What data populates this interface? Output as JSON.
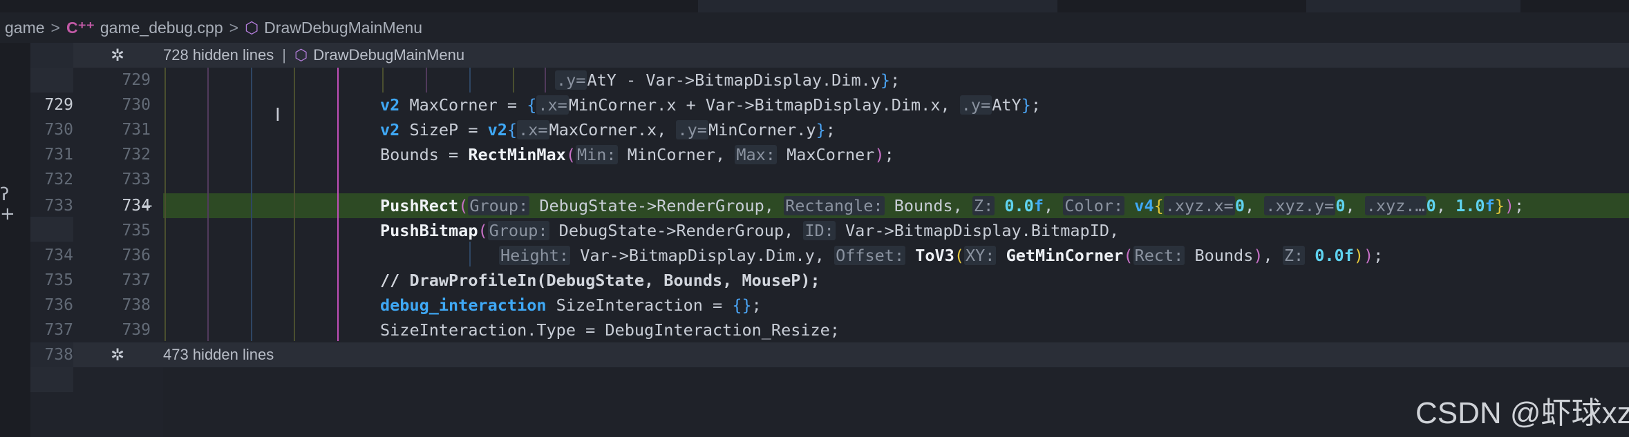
{
  "breadcrumb": {
    "folder": "game",
    "file": "game_debug.cpp",
    "symbol": "DrawDebugMainMenu",
    "separator": ">",
    "file_icon": "cpp-file-icon",
    "symbol_icon": "cube-symbol-icon"
  },
  "fold_top": {
    "icon": "fold-expand-icon",
    "text": "728 hidden lines",
    "separator": "|",
    "symbol": "DrawDebugMainMenu"
  },
  "fold_bottom": {
    "icon": "fold-expand-icon",
    "text": "473 hidden lines",
    "old_line": "738"
  },
  "rows": [
    {
      "old": "",
      "new": "729"
    },
    {
      "old": "729",
      "new": "730"
    },
    {
      "old": "730",
      "new": "731"
    },
    {
      "old": "731",
      "new": "732"
    },
    {
      "old": "732",
      "new": "733"
    },
    {
      "old": "733",
      "new": "734",
      "marker": "+"
    },
    {
      "old": "",
      "new": "735"
    },
    {
      "old": "734",
      "new": "736"
    },
    {
      "old": "735",
      "new": "737"
    },
    {
      "old": "736",
      "new": "738"
    },
    {
      "old": "737",
      "new": "739"
    }
  ],
  "code": {
    "l1": {
      "a": ".y=",
      "b": "AtY - Var->BitmapDisplay.Dim.y",
      "c": "}",
      "d": ";"
    },
    "l2": {
      "kw": "v2",
      "a": " MaxCorner = ",
      "b": "{",
      "h1": ".x=",
      "c": "MinCorner.x + Var->BitmapDisplay.Dim.x, ",
      "h2": ".y=",
      "d": "AtY",
      "e": "}",
      "f": ";"
    },
    "l3": {
      "kw1": "v2",
      "a": " SizeP = ",
      "kw2": "v2",
      "b": "{",
      "h1": ".x=",
      "c": "MaxCorner.x, ",
      "h2": ".y=",
      "d": "MinCorner.y",
      "e": "}",
      "f": ";"
    },
    "l4": {
      "a": "Bounds = ",
      "fn": "RectMinMax",
      "b": "(",
      "h1": "Min:",
      "c": " MinCorner, ",
      "h2": "Max:",
      "d": " MaxCorner",
      "e": ")",
      "f": ";"
    },
    "l6": {
      "fn": "PushRect",
      "b": "(",
      "h1": "Group:",
      "c": " DebugState->RenderGroup, ",
      "h2": "Rectangle:",
      "d": " Bounds, ",
      "h3": "Z:",
      "n1": " 0.0",
      "f1": "f",
      "e": ", ",
      "h4": "Color:",
      "kw": " v4",
      "g": "{",
      "h5": ".xyz.x=",
      "n2": "0",
      "i": ", ",
      "h6": ".xyz.y=",
      "n3": "0",
      "j": ", ",
      "h7": ".xyz.…",
      "n4": "0",
      "k": ", ",
      "n5": "1.0",
      "f2": "f",
      "l": "}",
      "m": ")",
      "z": ";"
    },
    "l7": {
      "fn": "PushBitmap",
      "b": "(",
      "h1": "Group:",
      "c": " DebugState->RenderGroup, ",
      "h2": "ID:",
      "d": " Var->BitmapDisplay.BitmapID,"
    },
    "l8": {
      "h1": "Height:",
      "a": " Var->BitmapDisplay.Dim.y, ",
      "h2": "Offset:",
      "fn1": " ToV3",
      "b": "(",
      "h3": "XY:",
      "fn2": " GetMinCorner",
      "c": "(",
      "h4": "Rect:",
      "d": " Bounds",
      "e": ")",
      "f": ", ",
      "h5": "Z:",
      "n": " 0.0f",
      "g": ")",
      "h": ")",
      "z": ";"
    },
    "l9": {
      "text": "// DrawProfileIn(DebugState, Bounds, MouseP);"
    },
    "l10": {
      "kw": "debug_interaction",
      "a": " SizeInteraction = ",
      "b": "{}",
      "c": ";"
    },
    "l11": {
      "text": "SizeInteraction.Type = DebugInteraction_Resize;"
    }
  },
  "margin": {
    "glyph1": "ʔ",
    "glyph2": "+"
  },
  "cursor": "I",
  "watermark": "CSDN @虾球xz",
  "colors": {
    "added_line": "#2d4a24",
    "keyword": "#3fa8f5",
    "number": "#5fd3f0"
  }
}
